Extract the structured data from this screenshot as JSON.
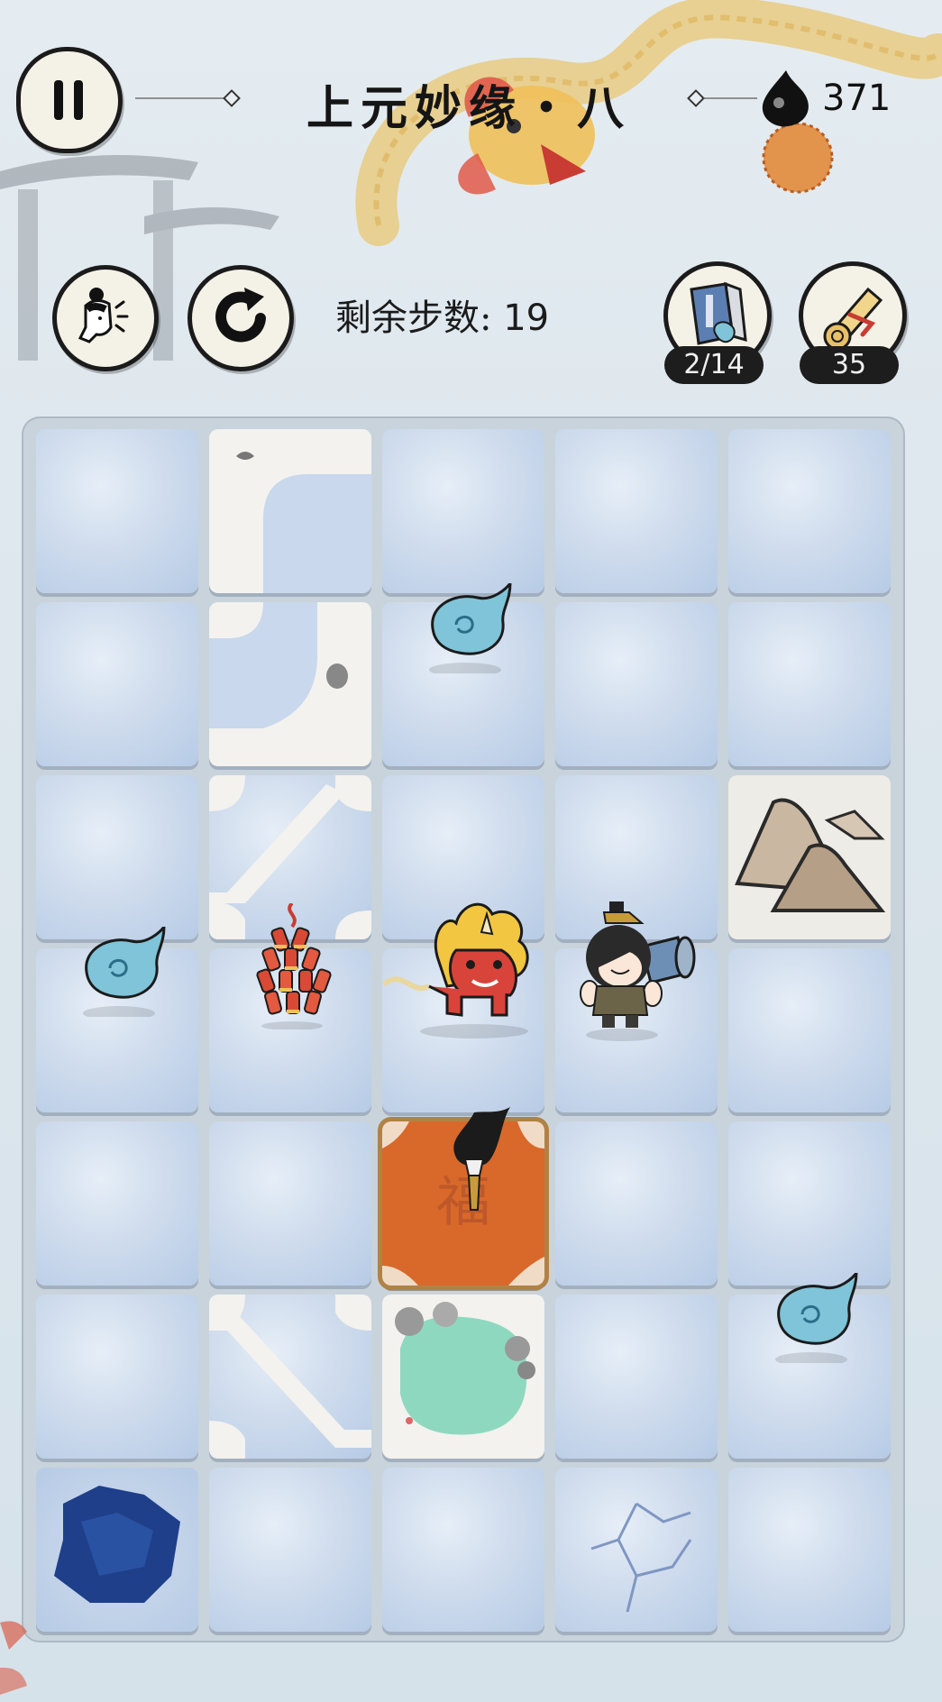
{
  "header": {
    "title": "上元妙缘・八",
    "ink_count": "371"
  },
  "toolbar": {
    "steps_label": "剩余步数:",
    "steps_value": "19"
  },
  "items": {
    "book_progress": "2/14",
    "scroll_count": "35"
  },
  "icons": {
    "pause": "pause-icon",
    "hint": "hint-person-icon",
    "restart": "restart-icon",
    "ink": "ink-drop-icon",
    "book": "book-icon",
    "scroll": "scroll-icon"
  },
  "board": {
    "rows": 7,
    "cols": 5,
    "tiles": [
      [
        "ice",
        "path-curve-tr",
        "ice",
        "ice",
        "ice"
      ],
      [
        "ice",
        "path-curve-bl",
        "ice",
        "ice",
        "ice"
      ],
      [
        "ice",
        "path-diagonal",
        "ice",
        "ice",
        "mountain"
      ],
      [
        "ice",
        "ice",
        "ice",
        "ice",
        "ice"
      ],
      [
        "ice",
        "ice",
        "fu",
        "ice",
        "ice"
      ],
      [
        "ice",
        "path-diagonal-rev",
        "pond",
        "ice",
        "ice"
      ],
      [
        "hole",
        "ice",
        "ice",
        "cracked-ice",
        "ice"
      ]
    ],
    "objects": [
      {
        "type": "spirit-flame",
        "row": 1,
        "col": 2
      },
      {
        "type": "spirit-flame",
        "row": 3,
        "col": 0
      },
      {
        "type": "firecrackers",
        "row": 3,
        "col": 1
      },
      {
        "type": "nian-beast",
        "row": 3,
        "col": 2
      },
      {
        "type": "player-character",
        "row": 3,
        "col": 3
      },
      {
        "type": "ink-brush",
        "row": 4,
        "col": 2
      },
      {
        "type": "spirit-flame",
        "row": 5,
        "col": 4
      }
    ]
  },
  "colors": {
    "ice": "#cfdced",
    "path": "#f3f2ee",
    "fu": "#d8692a",
    "pond": "#8fd8c0",
    "hole": "#1f3f8a",
    "flame": "#7fc4d8"
  }
}
